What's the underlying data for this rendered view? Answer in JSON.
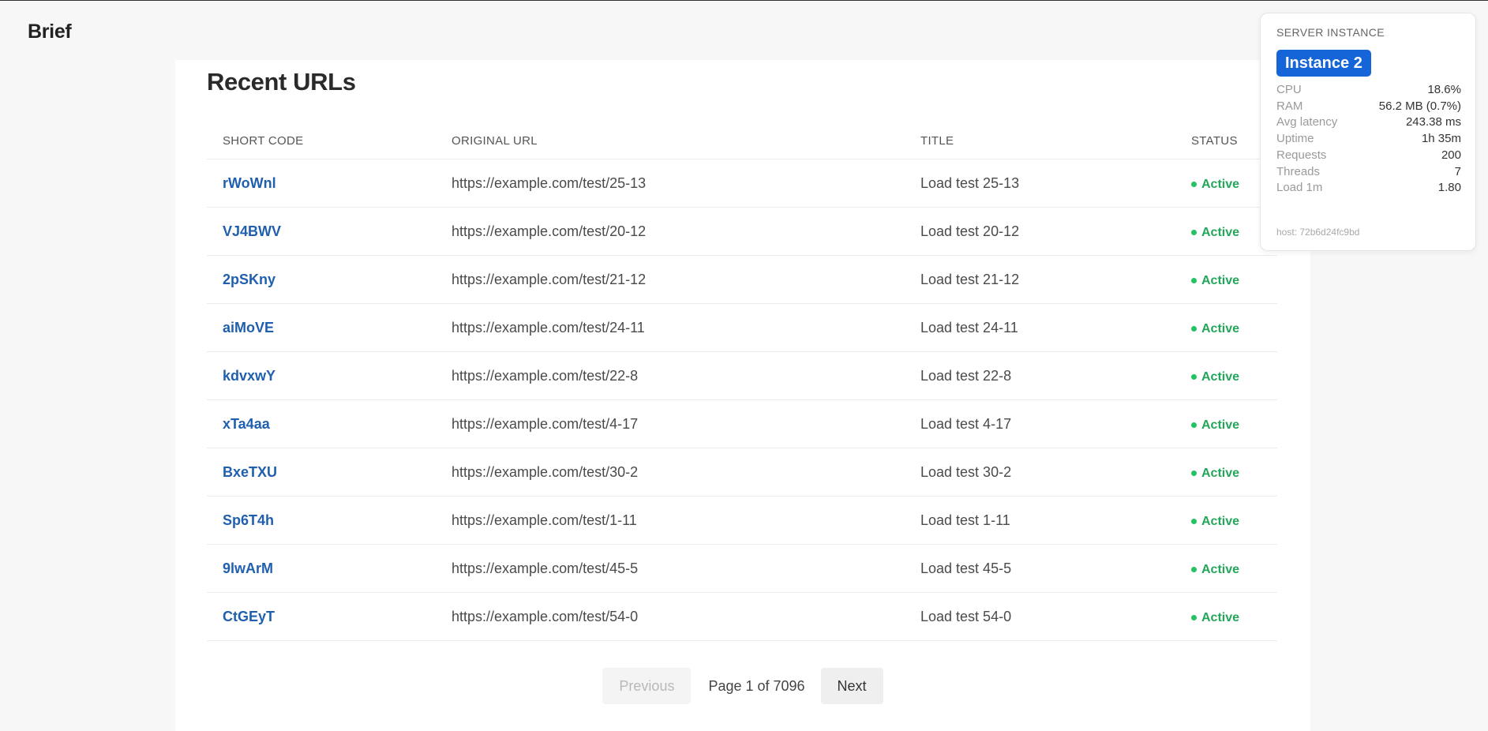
{
  "app": {
    "brand": "Brief"
  },
  "main": {
    "title": "Recent URLs",
    "columns": [
      "SHORT CODE",
      "ORIGINAL URL",
      "TITLE",
      "STATUS"
    ],
    "rows": [
      {
        "code": "rWoWnl",
        "url": "https://example.com/test/25-13",
        "title": "Load test 25-13",
        "status": "Active"
      },
      {
        "code": "VJ4BWV",
        "url": "https://example.com/test/20-12",
        "title": "Load test 20-12",
        "status": "Active"
      },
      {
        "code": "2pSKny",
        "url": "https://example.com/test/21-12",
        "title": "Load test 21-12",
        "status": "Active"
      },
      {
        "code": "aiMoVE",
        "url": "https://example.com/test/24-11",
        "title": "Load test 24-11",
        "status": "Active"
      },
      {
        "code": "kdvxwY",
        "url": "https://example.com/test/22-8",
        "title": "Load test 22-8",
        "status": "Active"
      },
      {
        "code": "xTa4aa",
        "url": "https://example.com/test/4-17",
        "title": "Load test 4-17",
        "status": "Active"
      },
      {
        "code": "BxeTXU",
        "url": "https://example.com/test/30-2",
        "title": "Load test 30-2",
        "status": "Active"
      },
      {
        "code": "Sp6T4h",
        "url": "https://example.com/test/1-11",
        "title": "Load test 1-11",
        "status": "Active"
      },
      {
        "code": "9lwArM",
        "url": "https://example.com/test/45-5",
        "title": "Load test 45-5",
        "status": "Active"
      },
      {
        "code": "CtGEyT",
        "url": "https://example.com/test/54-0",
        "title": "Load test 54-0",
        "status": "Active"
      }
    ],
    "pagination": {
      "previous": "Previous",
      "info": "Page 1 of 7096",
      "next": "Next"
    }
  },
  "server_panel": {
    "heading": "SERVER INSTANCE",
    "instance": "Instance 2",
    "metrics": [
      {
        "label": "CPU",
        "value": "18.6%"
      },
      {
        "label": "RAM",
        "value": "56.2 MB (0.7%)"
      },
      {
        "label": "Avg latency",
        "value": "243.38 ms"
      },
      {
        "label": "Uptime",
        "value": "1h 35m"
      },
      {
        "label": "Requests",
        "value": "200"
      },
      {
        "label": "Threads",
        "value": "7"
      },
      {
        "label": "Load 1m",
        "value": "1.80"
      }
    ],
    "host": "host: 72b6d24fc9bd"
  },
  "colors": {
    "link": "#1f5fad",
    "active": "#23a55a",
    "badge": "#1565d8"
  }
}
